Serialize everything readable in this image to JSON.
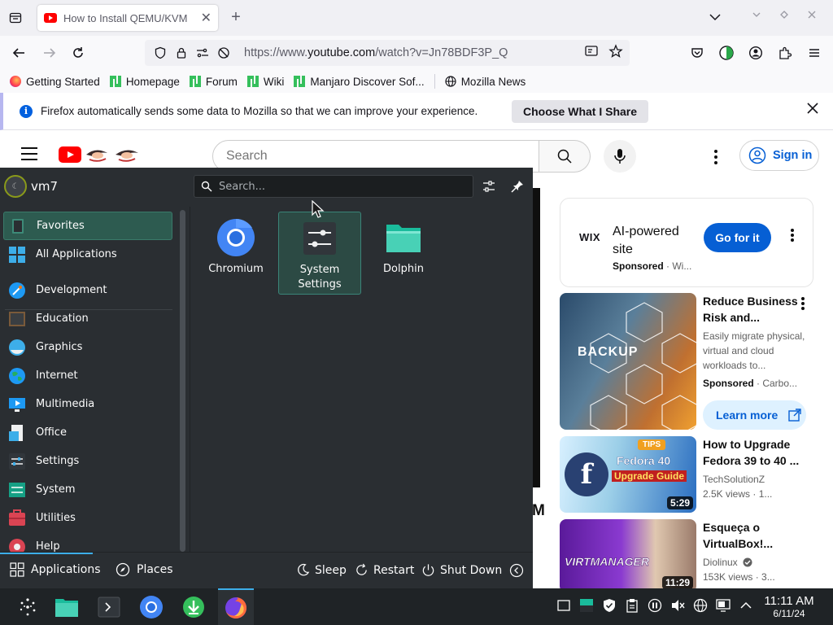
{
  "browser": {
    "tab": {
      "title": "How to Install QEMU/KVM",
      "close": "✕"
    },
    "new_tab": "+",
    "url_host": "https://www.",
    "url_domain": "youtube.com",
    "url_path": "/watch?v=Jn78BDF3P_Q",
    "bookmarks": [
      {
        "label": "Getting Started",
        "icon": "firefox-icon"
      },
      {
        "label": "Homepage",
        "icon": "manjaro-icon"
      },
      {
        "label": "Forum",
        "icon": "manjaro-icon"
      },
      {
        "label": "Wiki",
        "icon": "manjaro-icon"
      },
      {
        "label": "Manjaro Discover Sof...",
        "icon": "manjaro-icon"
      },
      {
        "label": "Mozilla News",
        "icon": "globe-icon"
      }
    ],
    "notification": {
      "message": "Firefox automatically sends some data to Mozilla so that we can improve your experience.",
      "button": "Choose What I Share"
    }
  },
  "youtube": {
    "search_placeholder": "Search",
    "sign_in": "Sign in",
    "video_title_fragment": "M",
    "ad": {
      "brand": "WIX",
      "title": "AI-powered site",
      "sponsored": "Sponsored",
      "advertiser": "Wi...",
      "cta": "Go for it"
    },
    "recommendations": [
      {
        "title": "Reduce Business Risk and...",
        "desc": "Easily migrate physical, virtual and cloud workloads to...",
        "sponsored": "Sponsored",
        "channel": "Carbo...",
        "cta": "Learn more",
        "thumb_text": "BACKUP"
      },
      {
        "title": "How to Upgrade Fedora 39 to 40 ...",
        "channel": "TechSolutionZ",
        "views": "2.5K views",
        "age": "1...",
        "duration": "5:29",
        "thumb_badge": "TIPS",
        "thumb_line1": "Fedora 40",
        "thumb_line2": "Upgrade Guide"
      },
      {
        "title": "Esqueça o VirtualBox!...",
        "channel": "Diolinux",
        "views": "153K views",
        "age": "3...",
        "duration": "11:29",
        "thumb_text": "VIRTMANAGER"
      }
    ]
  },
  "launcher": {
    "user": "vm7",
    "search_placeholder": "Search...",
    "categories": [
      {
        "label": "Favorites",
        "icon": "favorites-icon",
        "selected": true
      },
      {
        "label": "All Applications",
        "icon": "all-apps-icon"
      },
      {
        "label": "Development",
        "icon": "development-icon"
      },
      {
        "label": "Education",
        "icon": "education-icon"
      },
      {
        "label": "Graphics",
        "icon": "graphics-icon"
      },
      {
        "label": "Internet",
        "icon": "internet-icon"
      },
      {
        "label": "Multimedia",
        "icon": "multimedia-icon"
      },
      {
        "label": "Office",
        "icon": "office-icon"
      },
      {
        "label": "Settings",
        "icon": "settings-icon"
      },
      {
        "label": "System",
        "icon": "system-icon"
      },
      {
        "label": "Utilities",
        "icon": "utilities-icon"
      },
      {
        "label": "Help",
        "icon": "help-icon"
      }
    ],
    "favorites": [
      {
        "label": "Chromium",
        "icon": "chromium-icon"
      },
      {
        "label": "System Settings",
        "icon": "system-settings-icon",
        "highlighted": true
      },
      {
        "label": "Dolphin",
        "icon": "dolphin-folder-icon"
      }
    ],
    "footer": {
      "tab_applications": "Applications",
      "tab_places": "Places",
      "sleep": "Sleep",
      "restart": "Restart",
      "shutdown": "Shut Down"
    }
  },
  "taskbar": {
    "time": "11:11 AM",
    "date": "6/11/24",
    "accent": "#3daee9"
  }
}
